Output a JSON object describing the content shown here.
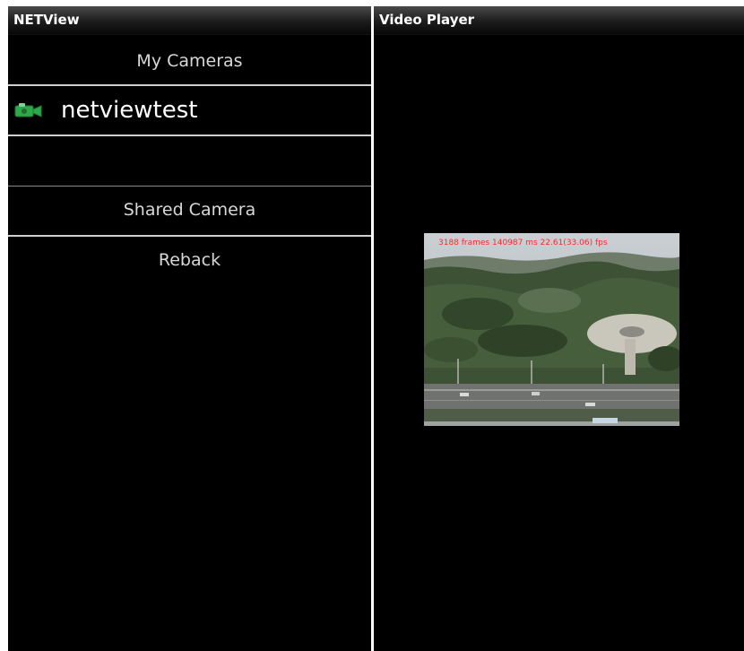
{
  "left_panel": {
    "title": "NETView",
    "my_cameras_label": "My Cameras",
    "camera_item": {
      "name": "netviewtest",
      "icon": "camera-icon"
    },
    "shared_camera_label": "Shared Camera",
    "reback_label": "Reback"
  },
  "right_panel": {
    "title": "Video Player",
    "video_overlay": "3188 frames 140987 ms 22.61(33.06) fps"
  },
  "colors": {
    "icon_green": "#2ea84a",
    "overlay_red": "#ff2a2a",
    "divider": "#cfcfcf"
  }
}
